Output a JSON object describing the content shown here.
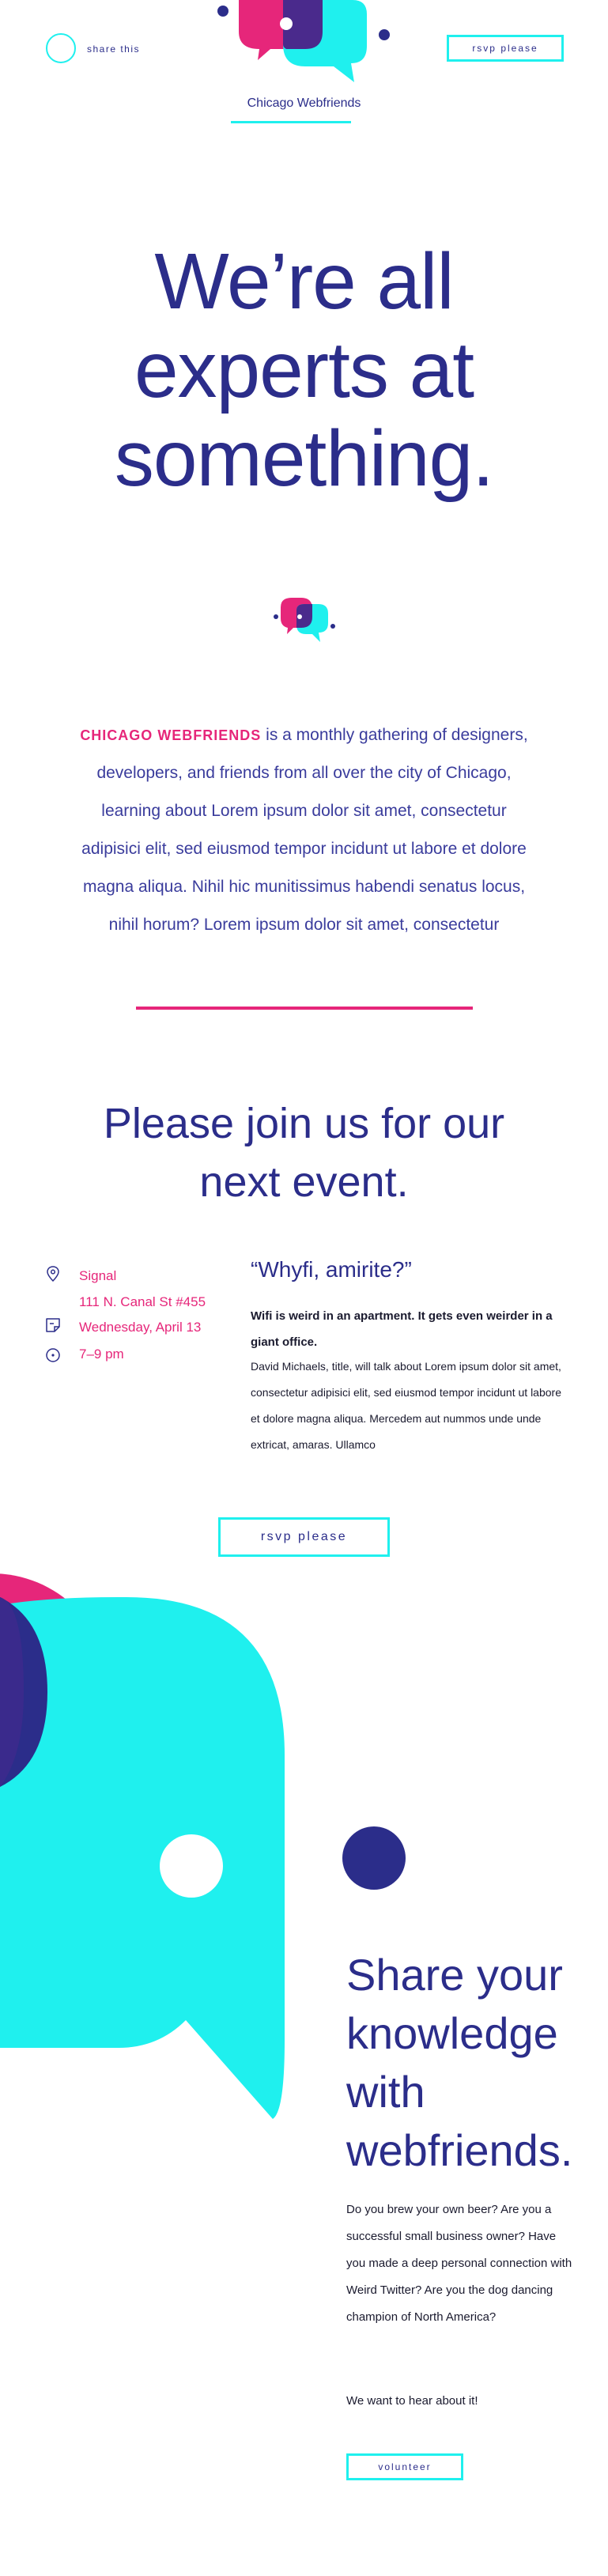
{
  "header": {
    "share_label": "share this",
    "rsvp_label": "rsvp please",
    "brand": "Chicago Webfriends"
  },
  "hero": {
    "lines": [
      "We’re all",
      "experts at",
      "something."
    ]
  },
  "intro": {
    "highlight": "CHICAGO WEBFRIENDS",
    "lines": [
      " is a monthly gathering of designers,",
      "developers, and friends from all over the city of Chicago,",
      "learning about Lorem ipsum dolor sit amet, consectetur",
      "adipisici elit, sed eiusmod tempor incidunt ut labore et dolore",
      "magna aliqua. Nihil hic munitissimus habendi senatus locus,",
      "nihil horum? Lorem ipsum dolor sit amet, consectetur"
    ]
  },
  "event": {
    "heading_lines": [
      "Please join us for our",
      "next event."
    ],
    "venue": "Signal",
    "address": "111 N. Canal St #455",
    "date": "Wednesday, April 13",
    "time": "7–9 pm",
    "talk_title": "“Whyfi, amirite?”",
    "talk_subtitle": "Wifi is weird in an apartment. It gets even weirder in a giant office.",
    "talk_body": "David Michaels, title, will talk about Lorem ipsum dolor sit amet, consectetur adipisici elit, sed eiusmod tempor incidunt ut labore et dolore magna aliqua. Mercedem aut nummos unde unde extricat, amaras. Ullamco",
    "rsvp_label": "rsvp please"
  },
  "share": {
    "heading_lines": [
      "Share your",
      "knowledge",
      "with",
      "webfriends."
    ],
    "paragraph": "Do you brew your own beer? Are you a successful small business owner? Have you made a deep personal connection with Weird Twitter? Are you the dog dancing champion of North America?",
    "cta_text": "We want to hear about it!",
    "volunteer_label": "volunteer"
  },
  "colors": {
    "navy": "#2b2d8a",
    "cyan": "#1ff0ee",
    "pink": "#e6267a",
    "purple": "#4a2a8c"
  },
  "icons": [
    "share-circle-icon",
    "location-pin-icon",
    "calendar-icon",
    "clock-icon",
    "chat-bubbles-logo"
  ]
}
